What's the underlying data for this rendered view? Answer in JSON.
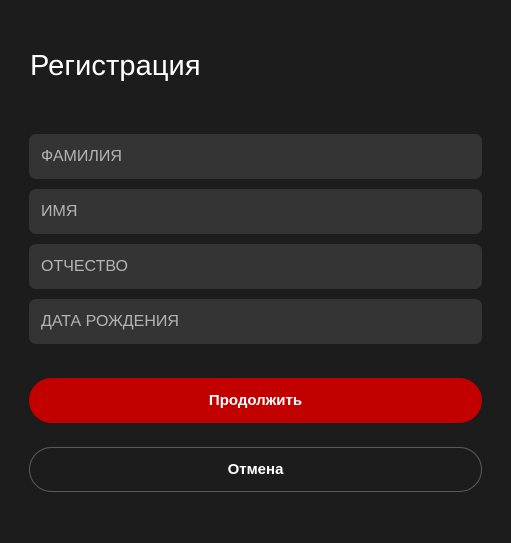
{
  "dialog": {
    "title": "Регистрация",
    "fields": {
      "last_name": {
        "placeholder": "ФАМИЛИЯ",
        "value": ""
      },
      "first_name": {
        "placeholder": "ИМЯ",
        "value": ""
      },
      "patronymic": {
        "placeholder": "ОТЧЕСТВО",
        "value": ""
      },
      "birth_date": {
        "placeholder": "ДАТА РОЖДЕНИЯ",
        "value": ""
      }
    },
    "continue_label": "Продолжить",
    "cancel_label": "Отмена"
  },
  "colors": {
    "background": "#1c1c1c",
    "field_background": "#343434",
    "primary": "#c20000",
    "outline": "#5a5a5a",
    "text": "#ffffff",
    "placeholder": "#b4b4b4"
  }
}
